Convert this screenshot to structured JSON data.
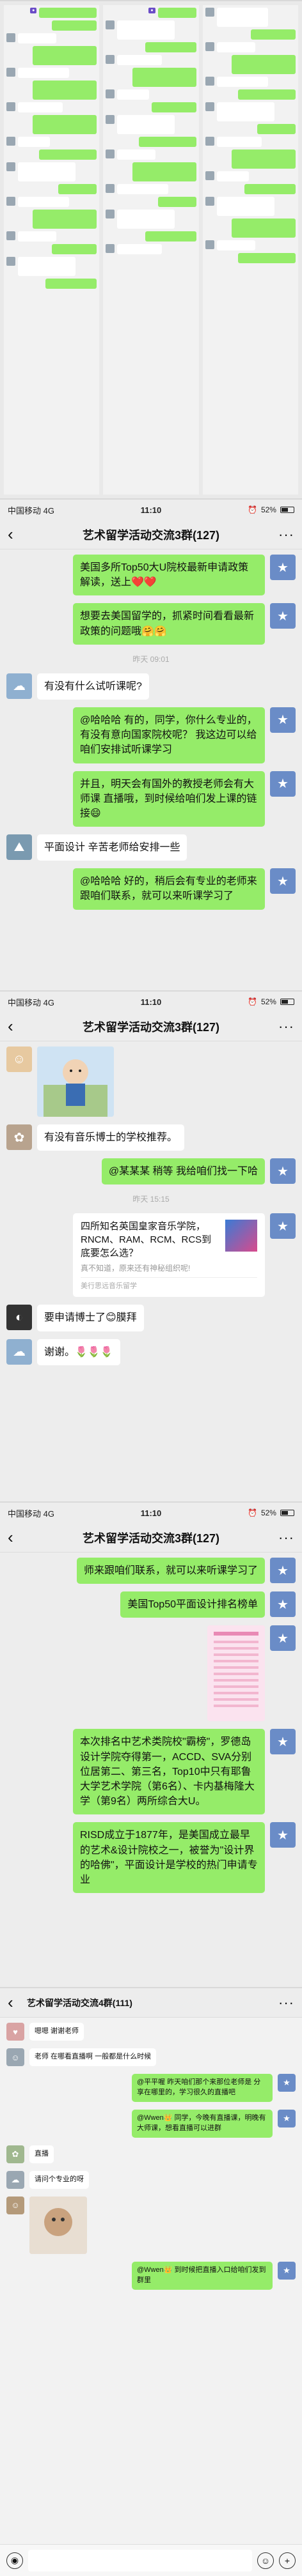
{
  "status": {
    "carrier": "中国移动",
    "network": "4G",
    "time": "11:10",
    "battery": "52%"
  },
  "thumbs": {
    "line_a": "",
    "line_b": ""
  },
  "chat_title": "艺术留学活动交流3群(127)",
  "screen2": {
    "messages": [
      {
        "side": "right",
        "text": "美国多所Top50大U院校最新申请政策解读，送上❤️❤️"
      },
      {
        "side": "right",
        "text": "想要去美国留学的，抓紧时间看看最新政策的问题哦🤗🤗"
      },
      {
        "side": "time",
        "text": "昨天 09:01"
      },
      {
        "side": "left",
        "text": "有没有什么试听课呢?"
      },
      {
        "side": "right",
        "text": "@哈哈哈  有的，同学，你什么专业的，有没有意向国家院校呢？ 我这边可以给咱们安排试听课学习"
      },
      {
        "side": "right",
        "text": "并且，明天会有国外的教授老师会有大师课 直播哦，到时候给咱们发上课的链接😄"
      },
      {
        "side": "left",
        "text": "平面设计  辛苦老师给安排一些"
      },
      {
        "side": "right",
        "text": "@哈哈哈  好的，稍后会有专业的老师来跟咱们联系，就可以来听课学习了"
      }
    ]
  },
  "screen3": {
    "messages": [
      {
        "side": "left",
        "text": "有没有音乐博士的学校推荐。"
      },
      {
        "side": "right",
        "text": "@某某某  稍等  我给咱们找一下哈"
      },
      {
        "side": "time",
        "text": "昨天 15:15"
      },
      {
        "side": "card",
        "title": "四所知名英国皇家音乐学院，RNCM、RAM、RCM、RCS到底要怎么选？",
        "desc": "真不知道，原来还有神秘组织呢!",
        "footer": "美行思远音乐留学"
      },
      {
        "side": "left",
        "text": "要申请博士了😊膜拜"
      },
      {
        "side": "left",
        "text": "谢谢。🌷🌷🌷"
      }
    ]
  },
  "screen4": {
    "messages": [
      {
        "side": "right",
        "text": "师来跟咱们联系，就可以来听课学习了"
      },
      {
        "side": "right",
        "text": "美国Top50平面设计排名榜单"
      },
      {
        "side": "right",
        "text": "本次排名中艺术类院校\"霸榜\"，罗德岛设计学院夺得第一，ACCD、SVA分别位居第二、第三名，Top10中只有耶鲁大学艺术学院（第6名）、卡内基梅隆大学（第9名）两所综合大U。"
      },
      {
        "side": "right",
        "text": "RISD成立于1877年，是美国成立最早的艺术&设计院校之一，被誉为\"设计界的哈佛\"，平面设计是学校的热门申请专业"
      }
    ]
  },
  "screen5": {
    "title": "艺术留学活动交流4群(111)",
    "messages": [
      {
        "side": "left",
        "text": "嗯嗯 谢谢老师"
      },
      {
        "side": "left",
        "text": "老师 在哪看直播啊 一般都是什么时候"
      },
      {
        "side": "right",
        "text": "@平平喔  昨天咱们那个来那位老师是 分享在哪里的，学习很久的直播吧"
      },
      {
        "side": "right",
        "text": "@Wwen👑  同学，今晚有直播课，明晚有大师课，想看直播可以进群"
      },
      {
        "side": "left",
        "text": "直播"
      },
      {
        "side": "left",
        "text": "请问个专业的呀"
      },
      {
        "side": "right",
        "text": "@Wwen👑  到时候把直播入口给咱们发到群里"
      }
    ]
  }
}
